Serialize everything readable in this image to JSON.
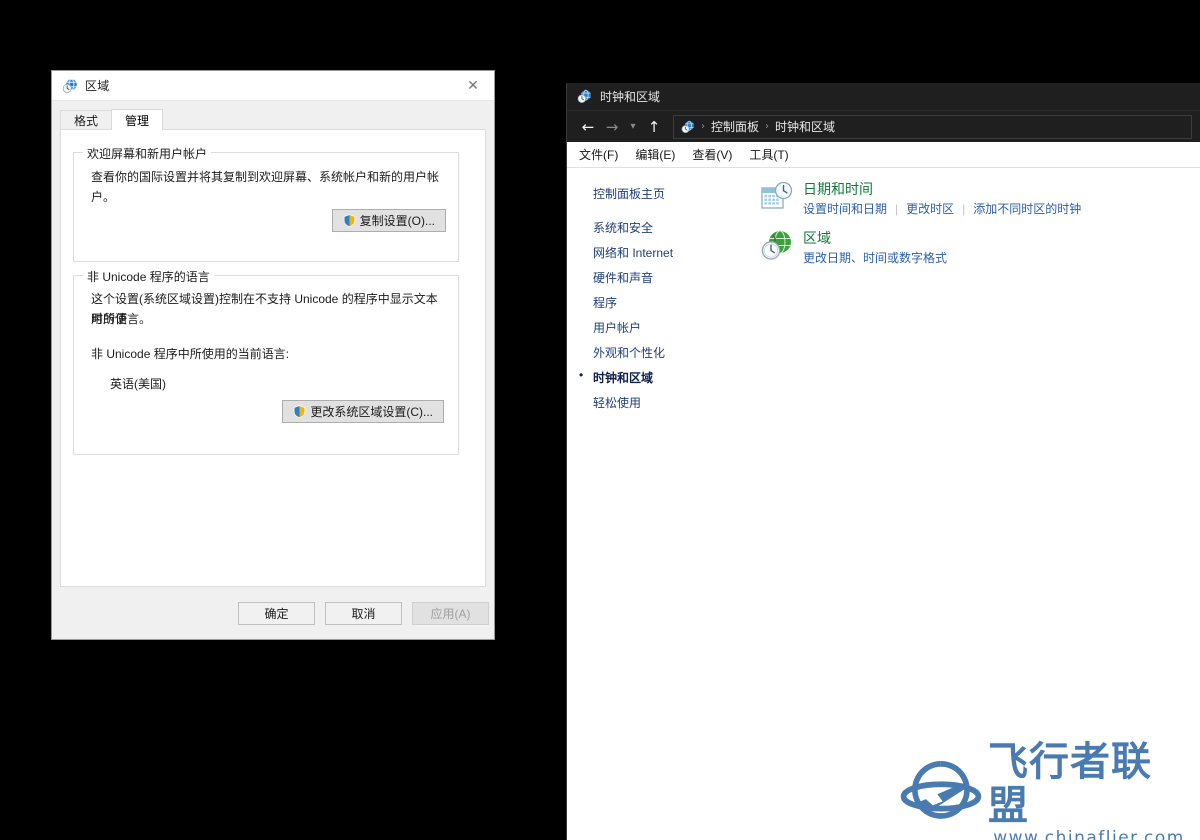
{
  "desktop": {
    "background_color": "#000000"
  },
  "region_dialog": {
    "title": "区域",
    "title_icon": "globe-clock-icon",
    "close_label": "✕",
    "tabs": [
      {
        "label": "格式",
        "active": false
      },
      {
        "label": "管理",
        "active": true
      }
    ],
    "welcome_group": {
      "legend": "欢迎屏幕和新用户帐户",
      "description": "查看你的国际设置并将其复制到欢迎屏幕、系统帐户和新的用户帐户。",
      "copy_button": "复制设置(O)..."
    },
    "nonunicode_group": {
      "legend": "非 Unicode 程序的语言",
      "description_line1": "这个设置(系统区域设置)控制在不支持 Unicode 的程序中显示文本时所使",
      "description_line2": "用的语言。",
      "current_label": "非 Unicode 程序中所使用的当前语言:",
      "current_value": "英语(美国)",
      "change_button": "更改系统区域设置(C)..."
    },
    "footer": {
      "ok": "确定",
      "cancel": "取消",
      "apply": "应用(A)",
      "apply_disabled": true
    },
    "colors": {
      "face": "#f0f0f0",
      "page": "#ffffff",
      "border": "#dcdcdc"
    }
  },
  "control_panel": {
    "title": "时钟和区域",
    "title_icon": "globe-clock-icon",
    "nav": {
      "back_icon": "arrow-left-icon",
      "forward_icon": "arrow-right-icon",
      "recent_icon": "chevron-down-icon",
      "up_icon": "arrow-up-icon",
      "address_icon": "globe-clock-icon",
      "breadcrumbs": [
        "控制面板",
        "时钟和区域"
      ],
      "separator": "›"
    },
    "menus": [
      "文件(F)",
      "编辑(E)",
      "查看(V)",
      "工具(T)"
    ],
    "sidebar": {
      "home": "控制面板主页",
      "items": [
        {
          "label": "系统和安全",
          "current": false
        },
        {
          "label": "网络和 Internet",
          "current": false
        },
        {
          "label": "硬件和声音",
          "current": false
        },
        {
          "label": "程序",
          "current": false
        },
        {
          "label": "用户帐户",
          "current": false
        },
        {
          "label": "外观和个性化",
          "current": false
        },
        {
          "label": "时钟和区域",
          "current": true
        },
        {
          "label": "轻松使用",
          "current": false
        }
      ]
    },
    "entries": [
      {
        "icon": "calendar-clock-icon",
        "title": "日期和时间",
        "links": [
          "设置时间和日期",
          "更改时区",
          "添加不同时区的时钟"
        ]
      },
      {
        "icon": "globe-clock-icon",
        "title": "区域",
        "links": [
          "更改日期、时间或数字格式"
        ]
      }
    ],
    "colors": {
      "titlebar": "#1f1f1f",
      "link": "#2b5faa",
      "heading": "#1f6f3c"
    }
  },
  "watermark": {
    "brand": "飞行者联盟",
    "url": "www.chinaflier.com",
    "logo_icon": "plane-orbit-logo-icon",
    "color": "#4a7bb0"
  }
}
